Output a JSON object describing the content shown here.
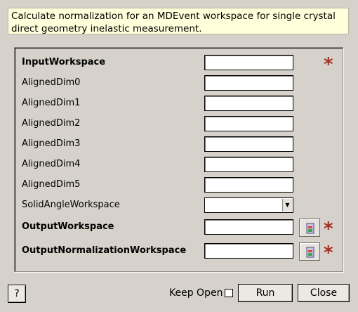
{
  "description": "Calculate normalization for an MDEvent workspace for single crystal direct geometry inelastic measurement.",
  "properties": [
    {
      "name": "InputWorkspace",
      "value": "",
      "mandatory": true
    },
    {
      "name": "AlignedDim0",
      "value": ""
    },
    {
      "name": "AlignedDim1",
      "value": ""
    },
    {
      "name": "AlignedDim2",
      "value": ""
    },
    {
      "name": "AlignedDim3",
      "value": ""
    },
    {
      "name": "AlignedDim4",
      "value": ""
    },
    {
      "name": "AlignedDim5",
      "value": ""
    },
    {
      "name": "SolidAngleWorkspace",
      "value": ""
    },
    {
      "name": "OutputWorkspace",
      "value": "",
      "mandatory": true
    },
    {
      "name": "OutputNormalizationWorkspace",
      "value": "",
      "mandatory": true
    }
  ],
  "mandatory_marker": "*",
  "buttons": {
    "help": "?",
    "keep_open": "Keep Open",
    "keep_open_checked": false,
    "run": "Run",
    "close": "Close"
  },
  "colors": {
    "mandatory_star": "#a23225",
    "description_background": "#ffffdc",
    "window_background": "#d6d2cb"
  }
}
